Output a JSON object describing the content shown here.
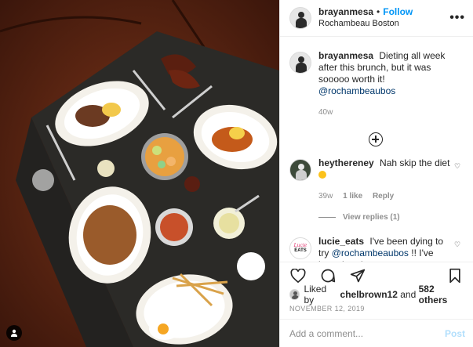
{
  "post": {
    "author": "brayanmesa",
    "dot": "•",
    "follow_label": "Follow",
    "location": "Rochambeau Boston",
    "more_label": "•••"
  },
  "caption": {
    "username": "brayanmesa",
    "text": "Dieting all week after this brunch, but it was sooooo worth it!",
    "mention": "@rochambeaubos",
    "time": "40w"
  },
  "comments": [
    {
      "username": "heythereney",
      "text": "Nah skip the diet",
      "emoji": "grinning-face",
      "time": "39w",
      "likes": "1 like",
      "reply_label": "Reply",
      "view_replies": "View replies (1)"
    },
    {
      "username": "lucie_eats",
      "text_before": "I've been dying to try",
      "mention": "@rochambeaubos",
      "text_after": "!! I've been hearing so many great things - what was your",
      "avatar_top": "Lucie",
      "avatar_bottom": "EATS"
    }
  ],
  "likes": {
    "prefix": "Liked by",
    "user": "chelbrown12",
    "conjunction": "and",
    "others": "582 others"
  },
  "date": "NOVEMBER 12, 2019",
  "add_comment": {
    "placeholder": "Add a comment...",
    "post_label": "Post"
  },
  "icons": [
    "heart-icon",
    "comment-icon",
    "share-icon",
    "bookmark-icon",
    "add-circle-icon",
    "person-tag-icon",
    "heart-small-icon"
  ],
  "colors": {
    "accent": "#0095f6",
    "link": "#00376b",
    "muted": "#8e8e8e",
    "post_disabled": "#b2dffc",
    "photo_bg": "#5a2413"
  }
}
